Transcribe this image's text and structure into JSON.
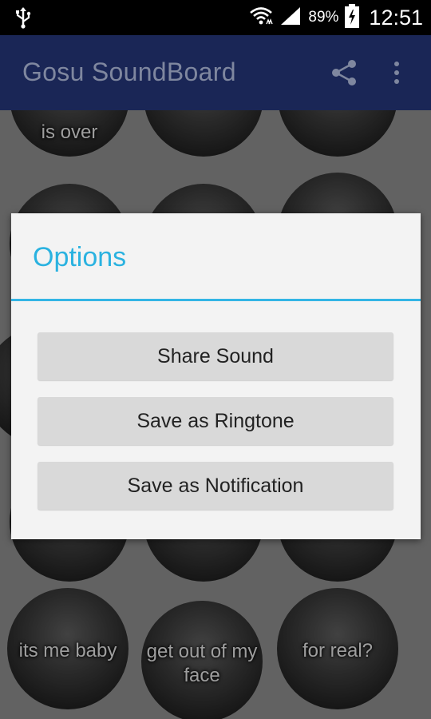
{
  "status_bar": {
    "battery_percent": "89%",
    "time": "12:51",
    "icons": [
      "usb-icon",
      "wifi-icon",
      "signal-icon",
      "battery-charging-icon"
    ]
  },
  "app_bar": {
    "title": "Gosu SoundBoard",
    "actions": [
      "share-icon",
      "overflow-menu-icon"
    ]
  },
  "sounds": [
    {
      "label": "is over"
    },
    {
      "label": ""
    },
    {
      "label": ""
    },
    {
      "label": "its me baby"
    },
    {
      "label": "get out of my face"
    },
    {
      "label": "for real?"
    }
  ],
  "dialog": {
    "title": "Options",
    "buttons": [
      {
        "label": "Share Sound"
      },
      {
        "label": "Save as Ringtone"
      },
      {
        "label": "Save as Notification"
      }
    ]
  }
}
